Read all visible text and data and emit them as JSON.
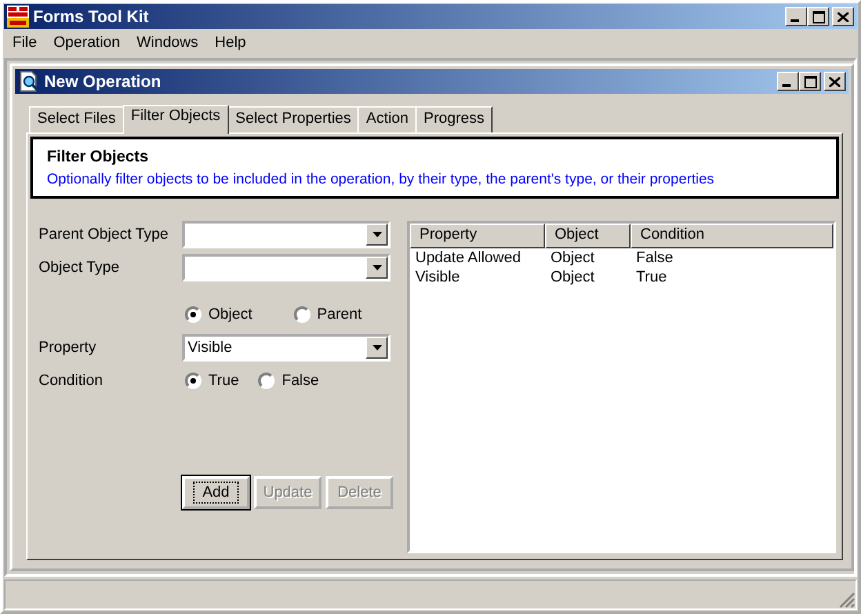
{
  "window": {
    "title": "Forms Tool Kit"
  },
  "menu": [
    "File",
    "Operation",
    "Windows",
    "Help"
  ],
  "child_window": {
    "title": "New Operation"
  },
  "tabs": [
    {
      "label": "Select Files",
      "selected": false
    },
    {
      "label": "Filter Objects",
      "selected": true
    },
    {
      "label": "Select Properties",
      "selected": false
    },
    {
      "label": "Action",
      "selected": false
    },
    {
      "label": "Progress",
      "selected": false
    }
  ],
  "header": {
    "title": "Filter Objects",
    "description": "Optionally filter objects to be included in the operation, by their type, the parent's type, or their properties"
  },
  "form": [
    {
      "kind": "combo",
      "label": "Parent Object Type"
    },
    {
      "kind": "combo",
      "label": "Object Type"
    },
    {
      "kind": "radios",
      "options": [
        {
          "label": "Object",
          "selected": true
        },
        {
          "label": "Parent",
          "selected": false
        }
      ]
    },
    {
      "kind": "combo",
      "label": "Property",
      "value": "Visible"
    },
    {
      "kind": "radios",
      "label": "Condition",
      "options": [
        {
          "label": "True",
          "selected": true
        },
        {
          "label": "False",
          "selected": false
        }
      ]
    }
  ],
  "buttons": [
    {
      "label": "Add",
      "disabled": false,
      "default": true
    },
    {
      "label": "Update",
      "disabled": true,
      "default": false
    },
    {
      "label": "Delete",
      "disabled": true,
      "default": false
    }
  ],
  "table": {
    "columns": [
      "Property",
      "Object",
      "Condition"
    ],
    "rows": [
      [
        "Update Allowed",
        "Object",
        "False"
      ],
      [
        "Visible",
        "Object",
        "True"
      ]
    ]
  }
}
